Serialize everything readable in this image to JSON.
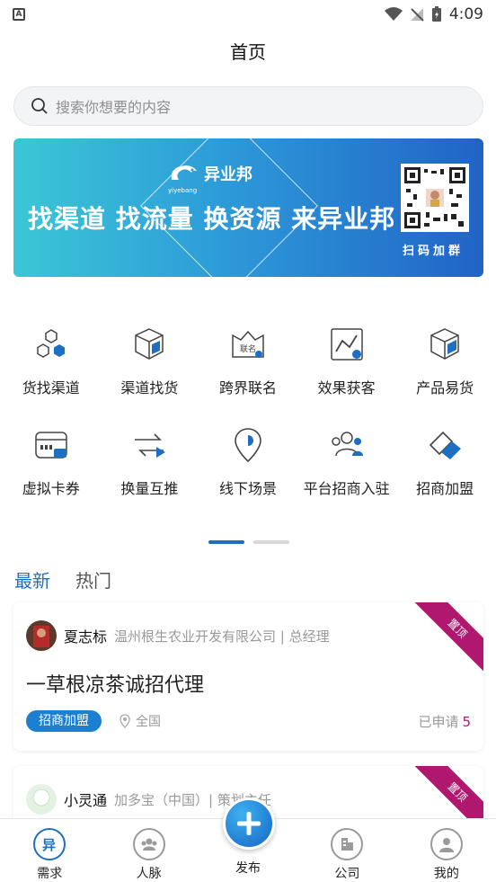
{
  "status_bar": {
    "time": "4:09",
    "notif_letter": "A"
  },
  "header": {
    "title": "首页"
  },
  "search": {
    "placeholder": "搜索你想要的内容"
  },
  "banner": {
    "logo_text": "异业邦",
    "logo_sub": "yiyebang",
    "slogan": "找渠道 找流量 换资源 来异业邦",
    "qr_label": "扫码加群"
  },
  "categories": [
    {
      "label": "货找渠道",
      "icon": "hexagon-cubes-icon"
    },
    {
      "label": "渠道找货",
      "icon": "boxes-icon"
    },
    {
      "label": "跨界联名",
      "icon": "joint-name-icon"
    },
    {
      "label": "效果获客",
      "icon": "trend-chart-icon"
    },
    {
      "label": "产品易货",
      "icon": "product-box-icon"
    },
    {
      "label": "虚拟卡券",
      "icon": "card-coupon-icon"
    },
    {
      "label": "换量互推",
      "icon": "exchange-arrows-icon"
    },
    {
      "label": "线下场景",
      "icon": "location-pin-icon"
    },
    {
      "label": "平台招商入驻",
      "icon": "users-group-icon"
    },
    {
      "label": "招商加盟",
      "icon": "handshake-icon"
    }
  ],
  "feed": {
    "tabs": [
      "最新",
      "热门"
    ],
    "posts": [
      {
        "author": "夏志标",
        "company": "温州根生农业开发有限公司 | 总经理",
        "title": "一草根凉茶诚招代理",
        "tag": "招商加盟",
        "location": "全国",
        "applied_label": "已申请",
        "applied_count": "5",
        "pin": "置顶"
      },
      {
        "author": "小灵通",
        "company": "加多宝（中国）|   策划主任",
        "pin": "置顶"
      }
    ]
  },
  "bottom_nav": {
    "items": [
      "需求",
      "人脉",
      "发布",
      "公司",
      "我的"
    ]
  },
  "colors": {
    "accent": "#1d6fc2",
    "pin": "#b0186f"
  }
}
